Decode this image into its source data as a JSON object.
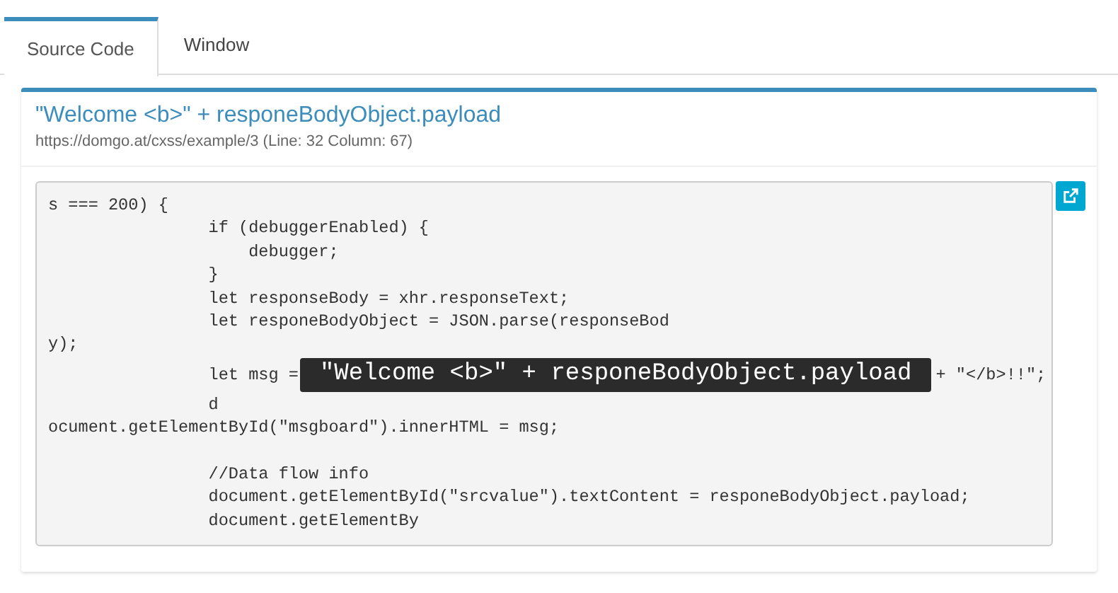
{
  "tabs": [
    {
      "label": "Source Code",
      "selected": true
    },
    {
      "label": "Window",
      "selected": false
    }
  ],
  "panel": {
    "title": "\"Welcome <b>\" + responeBodyObject.payload",
    "location": "https://domgo.at/cxss/example/3 (Line: 32 Column: 67)",
    "code_lines": [
      {
        "kind": "text",
        "text": "s === 200) {"
      },
      {
        "kind": "text",
        "text": "                if (debuggerEnabled) {"
      },
      {
        "kind": "text",
        "text": "                    debugger;"
      },
      {
        "kind": "text",
        "text": "                }"
      },
      {
        "kind": "text",
        "text": "                let responseBody = xhr.responseText;"
      },
      {
        "kind": "text",
        "text": "                let responeBodyObject = JSON.parse(responseBod"
      },
      {
        "kind": "text",
        "text": "y);"
      },
      {
        "kind": "highlight",
        "prefix": "                let msg =",
        "tooltip": "\"Welcome <b>\" + responeBodyObject.payload",
        "suffix": "+ \"</b>!!\";"
      },
      {
        "kind": "text",
        "text": "                d"
      },
      {
        "kind": "text",
        "text": "ocument.getElementById(\"msgboard\").innerHTML = msg;"
      },
      {
        "kind": "blank"
      },
      {
        "kind": "text",
        "text": "                //Data flow info"
      },
      {
        "kind": "text",
        "text": "                document.getElementById(\"srcvalue\").textContent = responeBodyObject.payload;"
      },
      {
        "kind": "text",
        "text": "                document.getElementBy"
      }
    ]
  }
}
